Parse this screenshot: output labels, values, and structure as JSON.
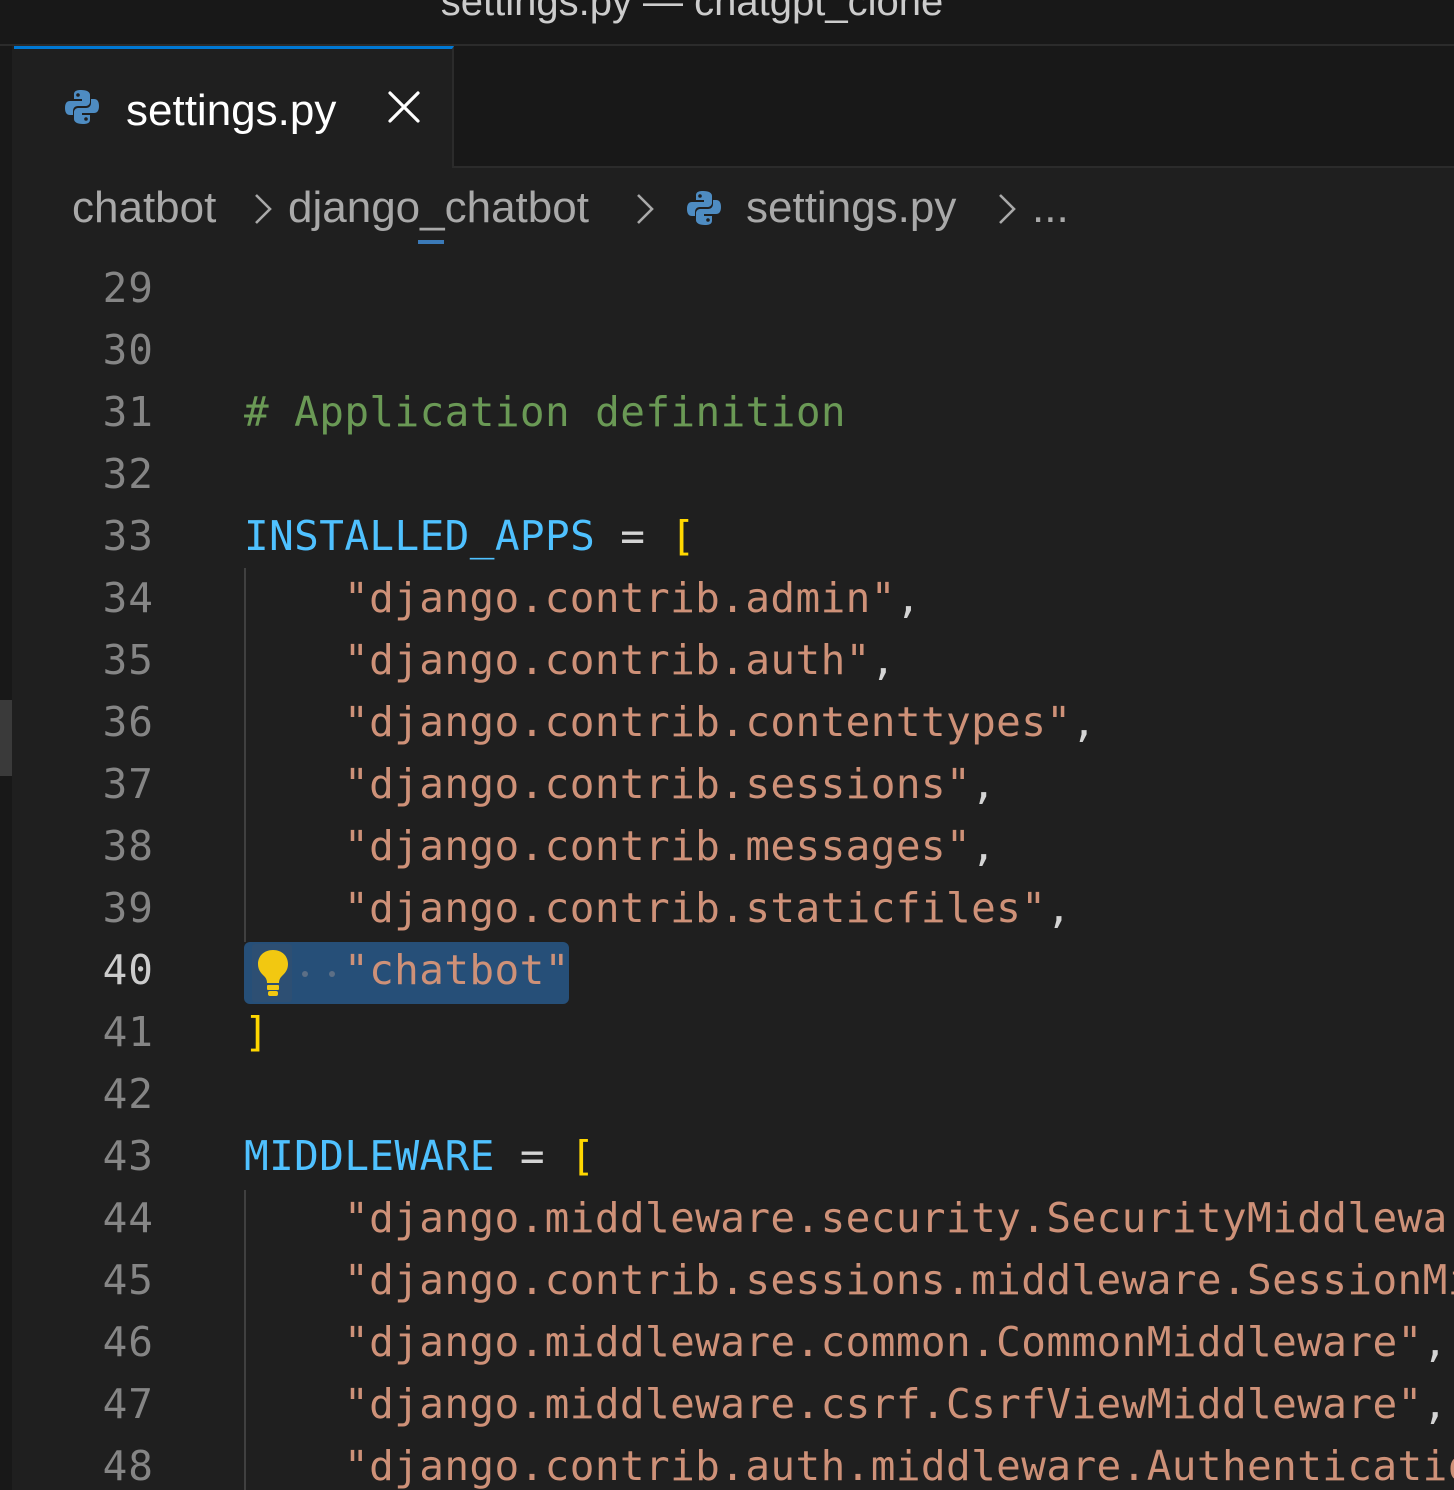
{
  "window": {
    "title": "settings.py — chatgpt_clone"
  },
  "tab": {
    "label": "settings.py",
    "icon": "python-icon",
    "close_icon": "close-icon"
  },
  "breadcrumb": {
    "items": [
      "chatbot",
      "django_chatbot",
      "settings.py",
      "..."
    ],
    "separator_icon": "chevron-right-icon"
  },
  "editor": {
    "active_line": "40",
    "lines": [
      {
        "n": "29",
        "text": ""
      },
      {
        "n": "30",
        "text": ""
      },
      {
        "n": "31",
        "comment": "# Application definition"
      },
      {
        "n": "32",
        "text": ""
      },
      {
        "n": "33",
        "name": "INSTALLED_APPS",
        "op": " = ",
        "bracket": "["
      },
      {
        "n": "34",
        "string": "\"django.contrib.admin\"",
        "punct": ","
      },
      {
        "n": "35",
        "string": "\"django.contrib.auth\"",
        "punct": ","
      },
      {
        "n": "36",
        "string": "\"django.contrib.contenttypes\"",
        "punct": ","
      },
      {
        "n": "37",
        "string": "\"django.contrib.sessions\"",
        "punct": ","
      },
      {
        "n": "38",
        "string": "\"django.contrib.messages\"",
        "punct": ","
      },
      {
        "n": "39",
        "string": "\"django.contrib.staticfiles\"",
        "punct": ","
      },
      {
        "n": "40",
        "string": "\"chatbot\"",
        "punct": ""
      },
      {
        "n": "41",
        "bracket": "]"
      },
      {
        "n": "42",
        "text": ""
      },
      {
        "n": "43",
        "name": "MIDDLEWARE",
        "op": " = ",
        "bracket": "["
      },
      {
        "n": "44",
        "string": "\"django.middleware.security.SecurityMiddleware\"",
        "punct": ","
      },
      {
        "n": "45",
        "string": "\"django.contrib.sessions.middleware.SessionMiddleware\"",
        "punct": ","
      },
      {
        "n": "46",
        "string": "\"django.middleware.common.CommonMiddleware\"",
        "punct": ","
      },
      {
        "n": "47",
        "string": "\"django.middleware.csrf.CsrfViewMiddleware\"",
        "punct": ","
      },
      {
        "n": "48",
        "string": "\"django.contrib.auth.middleware.AuthenticationMiddleware\"",
        "punct": ","
      }
    ],
    "lightbulb_icon": "lightbulb-icon"
  },
  "colors": {
    "accent": "#0078d4",
    "comment": "#6a9955",
    "constant": "#4fc1ff",
    "string": "#ce9178",
    "bracket": "#ffd700",
    "selection": "#264f78",
    "background": "#1f1f1f"
  }
}
